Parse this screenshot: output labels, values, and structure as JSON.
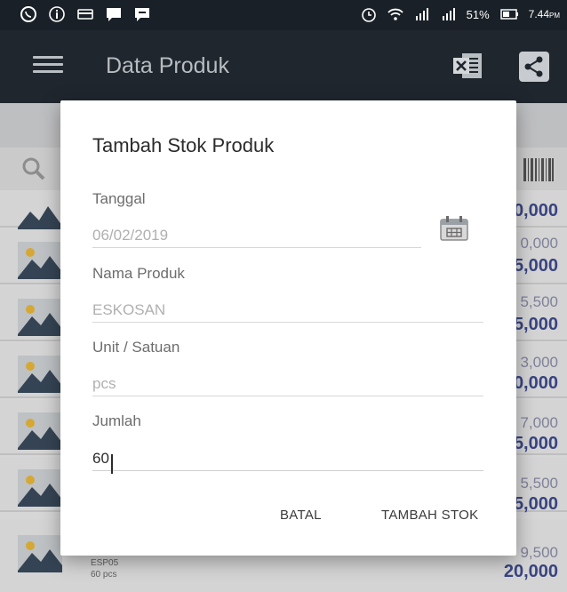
{
  "status_bar": {
    "battery": "51%",
    "time": "7.44",
    "time_suffix": "PM"
  },
  "app_bar": {
    "title": "Data Produk"
  },
  "background_list": {
    "rows": [
      {
        "price_top": "",
        "price": "0,000"
      },
      {
        "price_top": "0,000",
        "price": "5,000"
      },
      {
        "price_top": "5,500",
        "price": "5,000"
      },
      {
        "price_top": "3,000",
        "price": "0,000"
      },
      {
        "price_top": "7,000",
        "price": "5,000"
      },
      {
        "price_top": "5,500",
        "price": "5,000"
      },
      {
        "price_top": "9,500",
        "price": "20,000",
        "code": "ESP05",
        "unit": "60 pcs"
      }
    ]
  },
  "dialog": {
    "title": "Tambah Stok Produk",
    "tanggal_label": "Tanggal",
    "tanggal_value": "06/02/2019",
    "nama_label": "Nama Produk",
    "nama_value": "ESKOSAN",
    "unit_label": "Unit / Satuan",
    "unit_value": "pcs",
    "jumlah_label": "Jumlah",
    "jumlah_value": "60",
    "cancel_label": "BATAL",
    "confirm_label": "TAMBAH STOK"
  },
  "colors": {
    "appbar": "#1f262e",
    "price": "#3d4a8c"
  }
}
